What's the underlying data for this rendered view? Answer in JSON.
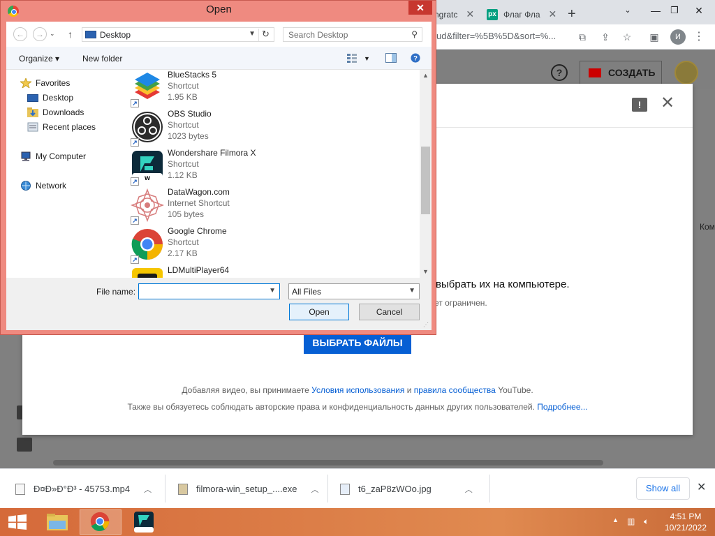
{
  "browser": {
    "tabs": [
      {
        "label": "ngratс",
        "favicon": "generic"
      },
      {
        "label": "Флаг Фла",
        "favicon": "px",
        "favicon_text": "px"
      }
    ],
    "new_tab_symbol": "+",
    "omnibox_text": "ud&filter=%5B%5D&sort=%...",
    "profile_initial": "И"
  },
  "youtube": {
    "create_label": "СОЗДАТЬ",
    "help_symbol": "?",
    "side_text": "Ком",
    "upload": {
      "main_text": "выбрать их на компьютере.",
      "sub_text": "ет ограничен.",
      "choose_button": "ВЫБРАТЬ ФАЙЛЫ",
      "terms_line1_prefix": "Добавляя видео, вы принимаете ",
      "terms_line1_link1": "Условия использования",
      "terms_line1_mid": " и ",
      "terms_line1_link2": "правила сообщества",
      "terms_line1_suffix": " YouTube.",
      "terms_line2_prefix": "Также вы обязуетесь соблюдать авторские права и конфиденциальность данных других пользователей. ",
      "terms_line2_link": "Подробнее..."
    }
  },
  "open_dialog": {
    "title": "Open",
    "address": "Desktop",
    "search_placeholder": "Search Desktop",
    "toolbar": {
      "organize": "Organize ▾",
      "new_folder": "New folder"
    },
    "nav": {
      "favorites": "Favorites",
      "desktop": "Desktop",
      "downloads": "Downloads",
      "recent": "Recent places",
      "computer": "My Computer",
      "network": "Network"
    },
    "files": [
      {
        "name": "BlueStacks 5",
        "type": "Shortcut",
        "size": "1.95 KB",
        "icon": "bluestacks-icon"
      },
      {
        "name": "OBS Studio",
        "type": "Shortcut",
        "size": "1023 bytes",
        "icon": "obs-icon"
      },
      {
        "name": "Wondershare Filmora X",
        "type": "Shortcut",
        "size": "1.12 KB",
        "icon": "filmora-icon"
      },
      {
        "name": "DataWagon.com",
        "type": "Internet Shortcut",
        "size": "105 bytes",
        "icon": "datawagon-icon"
      },
      {
        "name": "Google Chrome",
        "type": "Shortcut",
        "size": "2.17 KB",
        "icon": "chrome-icon"
      },
      {
        "name": "LDMultiPlayer64",
        "type": "",
        "size": "",
        "icon": "ldplayer-icon"
      }
    ],
    "file_name_label": "File name:",
    "file_name_value": "",
    "file_type": "All Files",
    "open_button": "Open",
    "cancel_button": "Cancel"
  },
  "downloads": [
    {
      "name": "Ð¤Ð»Ð°Ð³ - 45753.mp4"
    },
    {
      "name": "filmora-win_setup_....exe"
    },
    {
      "name": "t6_zaP8zWOo.jpg"
    }
  ],
  "downloads_show_all": "Show all",
  "taskbar": {
    "time": "4:51 PM",
    "date": "10/21/2022"
  }
}
